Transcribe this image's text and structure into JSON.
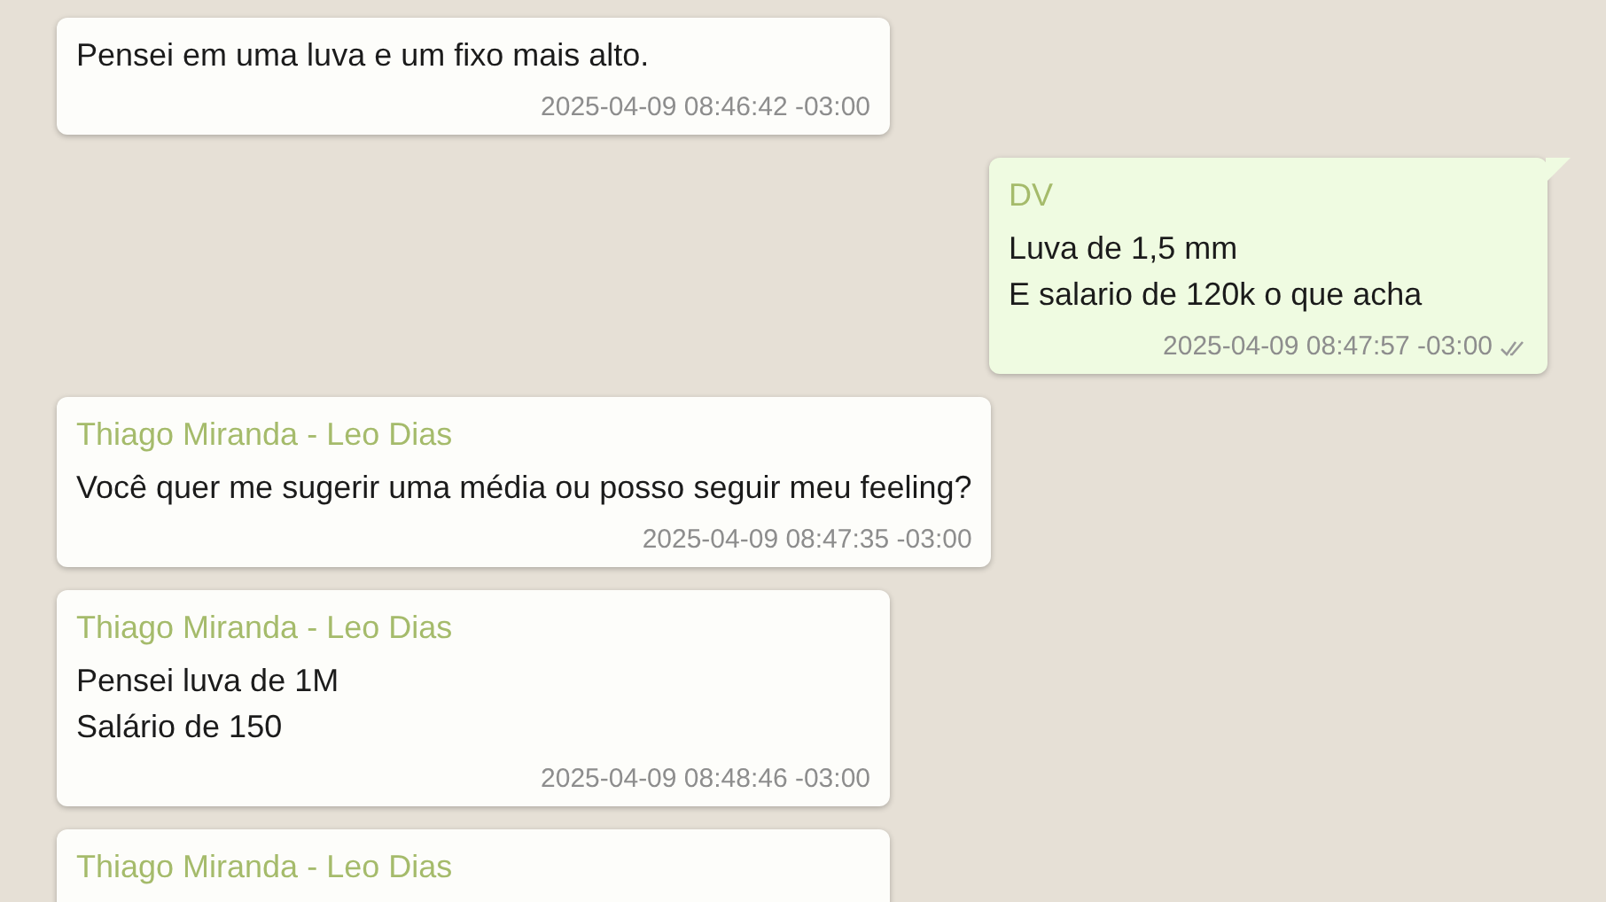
{
  "messages": [
    {
      "kind": "incoming",
      "lines": [
        "Pensei em uma luva e um fixo mais alto."
      ],
      "time": "2025-04-09 08:46:42 -03:00"
    },
    {
      "kind": "outgoing",
      "sender": "DV",
      "lines": [
        "Luva de 1,5 mm",
        "E salario de 120k o que acha"
      ],
      "time": "2025-04-09 08:47:57 -03:00",
      "read": false
    },
    {
      "kind": "incoming",
      "sender": "Thiago Miranda - Leo Dias",
      "lines": [
        "Você quer me sugerir uma média ou posso seguir meu feeling?"
      ],
      "time": "2025-04-09 08:47:35 -03:00"
    },
    {
      "kind": "incoming",
      "sender": "Thiago Miranda - Leo Dias",
      "lines": [
        "Pensei luva de 1M",
        "Salário de 150"
      ],
      "time": "2025-04-09 08:48:46 -03:00"
    },
    {
      "kind": "incoming",
      "sender": "Thiago Miranda - Leo Dias"
    }
  ]
}
